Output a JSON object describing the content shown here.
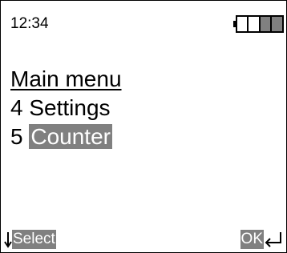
{
  "status": {
    "time": "12:34",
    "battery_icon": "battery-icon",
    "battery_level": 0.5
  },
  "menu": {
    "title": "Main menu",
    "items": [
      {
        "number": "4",
        "label": "Settings",
        "selected": false
      },
      {
        "number": "5",
        "label": "Counter",
        "selected": true
      }
    ]
  },
  "softkeys": {
    "left": {
      "icon": "down-arrow-icon",
      "label": "Select"
    },
    "right": {
      "label": "OK",
      "icon": "enter-return-icon"
    }
  },
  "colors": {
    "background": "#ffffff",
    "text": "#000000",
    "highlight": "#808080",
    "highlight_text": "#ffffff"
  }
}
